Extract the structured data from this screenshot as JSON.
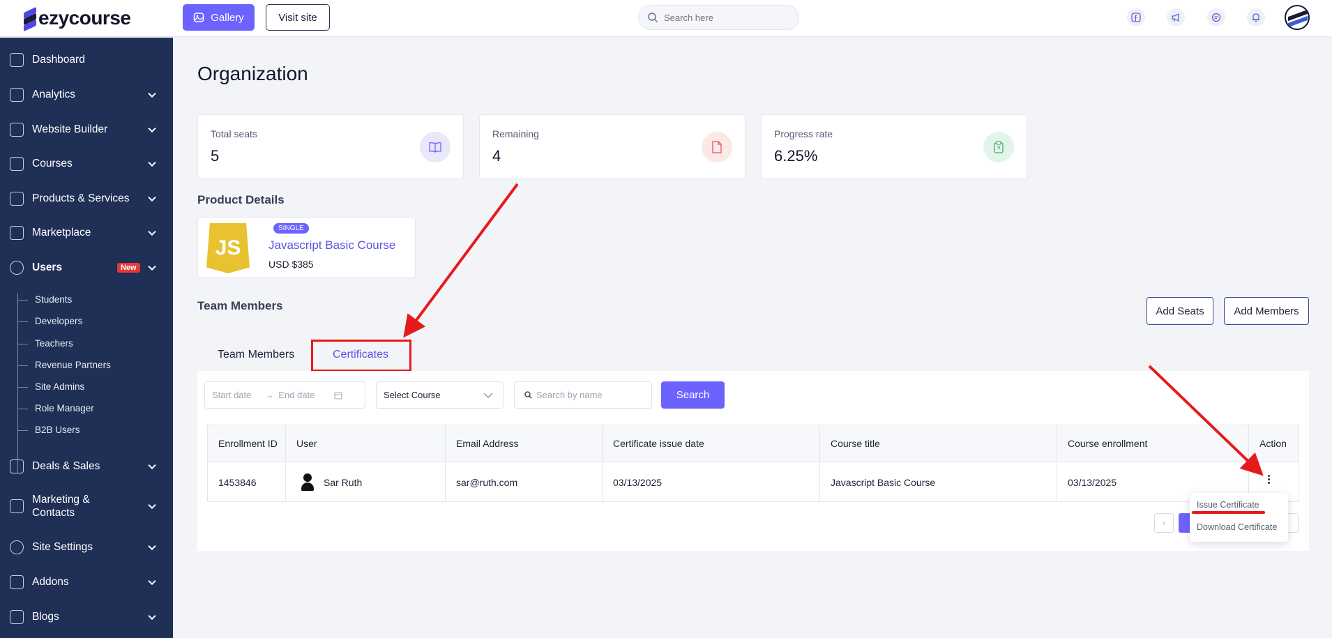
{
  "brand": {
    "name": "ezycourse"
  },
  "header": {
    "gallery_label": "Gallery",
    "visit_site_label": "Visit site",
    "search_placeholder": "Search here"
  },
  "sidebar": {
    "items": [
      {
        "label": "Dashboard",
        "icon": "grid-icon"
      },
      {
        "label": "Analytics",
        "icon": "chart-icon"
      },
      {
        "label": "Website Builder",
        "icon": "layout-icon"
      },
      {
        "label": "Courses",
        "icon": "teacher-icon"
      },
      {
        "label": "Products & Services",
        "icon": "box-icon"
      },
      {
        "label": "Marketplace",
        "icon": "store-icon"
      },
      {
        "label": "Users",
        "icon": "users-icon",
        "badge": "New"
      },
      {
        "label": "Deals & Sales",
        "icon": "tag-icon"
      },
      {
        "label": "Marketing & Contacts",
        "icon": "megaphone-icon"
      },
      {
        "label": "Site Settings",
        "icon": "gear-icon"
      },
      {
        "label": "Addons",
        "icon": "addon-icon"
      },
      {
        "label": "Blogs",
        "icon": "blog-icon"
      }
    ],
    "users_sub": [
      "Students",
      "Developers",
      "Teachers",
      "Revenue Partners",
      "Site Admins",
      "Role Manager",
      "B2B Users"
    ]
  },
  "main": {
    "title": "Organization",
    "stats": [
      {
        "label": "Total seats",
        "value": "5",
        "icon": "book-icon",
        "color": "#e9e8fb"
      },
      {
        "label": "Remaining",
        "value": "4",
        "icon": "file-icon",
        "color": "#fde8e8"
      },
      {
        "label": "Progress rate",
        "value": "6.25%",
        "icon": "clipboard-icon",
        "color": "#e3f5ea"
      }
    ],
    "product_details_heading": "Product Details",
    "product": {
      "badge": "SINGLE",
      "logo_text": "JS",
      "title": "Javascript Basic Course",
      "price": "USD $385"
    },
    "team_heading": "Team Members",
    "add_seats_label": "Add Seats",
    "add_members_label": "Add Members",
    "tabs": [
      {
        "label": "Team Members"
      },
      {
        "label": "Certificates",
        "active": true
      }
    ],
    "filters": {
      "start_date": "Start date",
      "end_date": "End date",
      "course_select": "Select Course",
      "search_placeholder": "Search by name",
      "search_button": "Search"
    },
    "table": {
      "headers": [
        "Enrollment ID",
        "User",
        "Email Address",
        "Certificate issue date",
        "Course title",
        "Course enrollment",
        "Action"
      ],
      "rows": [
        {
          "enrollment_id": "1453846",
          "user": "Sar Ruth",
          "email": "sar@ruth.com",
          "issue_date": "03/13/2025",
          "course_title": "Javascript Basic Course",
          "enrollment_date": "03/13/2025"
        }
      ]
    },
    "action_menu": [
      "Issue Certificate",
      "Download Certificate"
    ]
  },
  "colors": {
    "accent": "#6c63ff",
    "sidebar": "#1f2f56",
    "annotation": "#e51b1b"
  }
}
